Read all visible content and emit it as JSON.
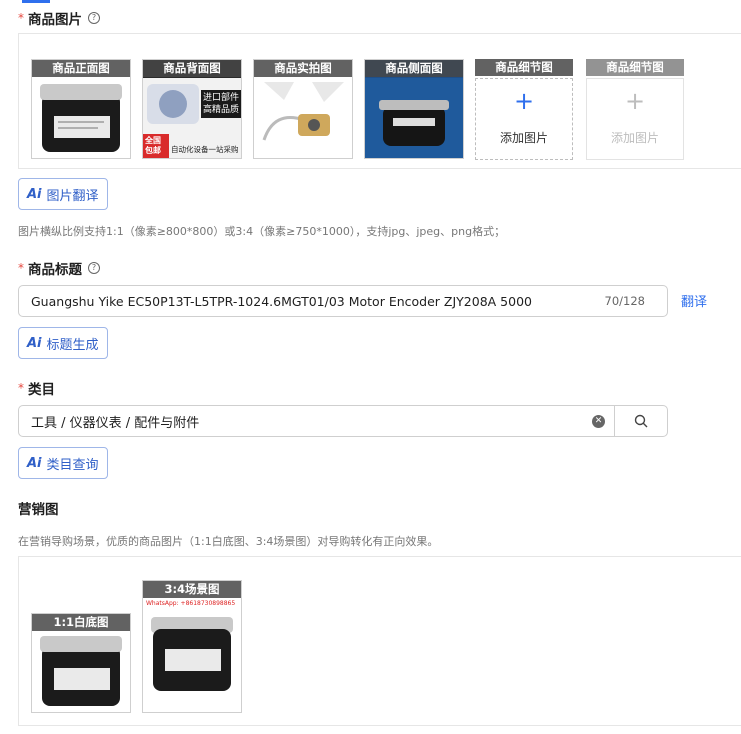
{
  "images_section": {
    "label": "商品图片",
    "required_mark": "*",
    "slots": [
      {
        "caption": "商品正面图"
      },
      {
        "caption": "商品背面图",
        "overlay_1": "进口部件",
        "overlay_2": "高精品质",
        "overlay_3": "全国包邮",
        "overlay_4": "自动化设备一站采购"
      },
      {
        "caption": "商品实拍图"
      },
      {
        "caption": "商品侧面图"
      }
    ],
    "add_slots": [
      {
        "caption": "商品细节图",
        "plus": "+",
        "label": "添加图片"
      },
      {
        "caption": "商品细节图",
        "plus": "+",
        "label": "添加图片"
      }
    ],
    "translate_button": "图片翻译",
    "hint": "图片横纵比例支持1:1（像素≥800*800）或3:4（像素≥750*1000），支持jpg、jpeg、png格式；"
  },
  "title_section": {
    "label": "商品标题",
    "required_mark": "*",
    "value": "Guangshu Yike EC50P13T-L5TPR-1024.6MGT01/03 Motor Encoder ZJY208A 5000",
    "counter": "70/128",
    "translate_link": "翻译",
    "generate_button": "标题生成"
  },
  "category_section": {
    "label": "类目",
    "required_mark": "*",
    "value": "工具 / 仪器仪表 / 配件与附件",
    "query_button": "类目查询"
  },
  "marketing_section": {
    "label": "营销图",
    "hint": "在营销导购场景，优质的商品图片（1:1白底图、3:4场景图）对导购转化有正向效果。",
    "slots": [
      {
        "caption": "1:1白底图"
      },
      {
        "caption": "3:4场景图",
        "watermark": "WhatsApp: +8618730898865"
      }
    ]
  },
  "ai_logo": "Ai",
  "colors": {
    "accent": "#2f6fed",
    "required": "#e5483f"
  }
}
